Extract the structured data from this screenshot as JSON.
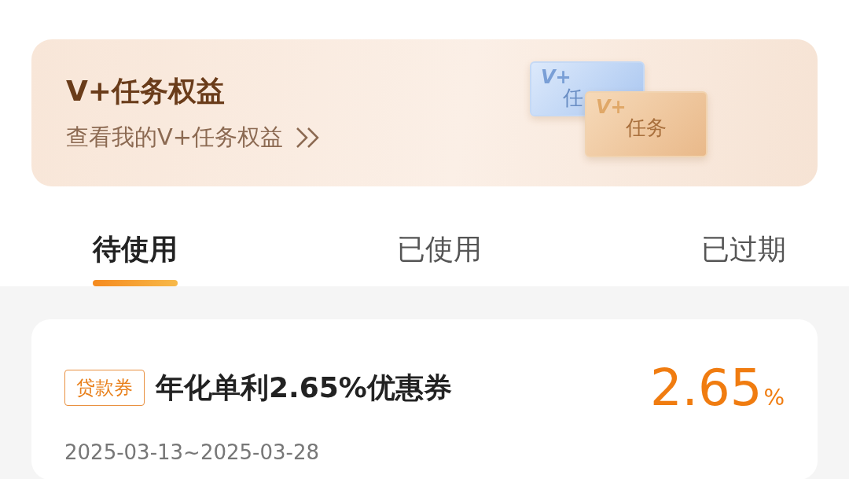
{
  "banner": {
    "title": "V+任务权益",
    "subtitle": "查看我的V+任务权益",
    "cards": [
      {
        "kind": "back",
        "top": "V+",
        "bottom": "任"
      },
      {
        "kind": "front",
        "top": "V+",
        "bottom": "任务"
      }
    ]
  },
  "tabs": [
    {
      "label": "待使用",
      "selected": true
    },
    {
      "label": "已使用",
      "selected": false
    },
    {
      "label": "已过期",
      "selected": false
    }
  ],
  "coupons": [
    {
      "tag": "贷款券",
      "title": "年化单利2.65%优惠券",
      "value": "2.65",
      "unit": "%",
      "dates": "2025-03-13~2025-03-28"
    }
  ]
}
